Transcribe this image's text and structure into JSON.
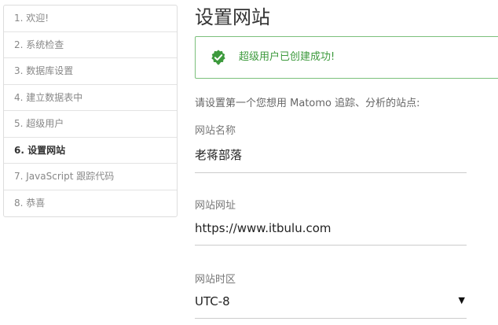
{
  "steps": [
    {
      "label": "1. 欢迎!"
    },
    {
      "label": "2. 系统检查"
    },
    {
      "label": "3. 数据库设置"
    },
    {
      "label": "4. 建立数据表中"
    },
    {
      "label": "5. 超级用户"
    },
    {
      "label": "6. 设置网站"
    },
    {
      "label": "7. JavaScript 跟踪代码"
    },
    {
      "label": "8. 恭喜"
    }
  ],
  "active_step_index": 5,
  "main": {
    "title": "设置网站",
    "alert": {
      "icon": "check-badge-icon",
      "message": "超级用户已创建成功!",
      "color": "#3d9a3d"
    },
    "intro": "请设置第一个您想用 Matomo 追踪、分析的站点:",
    "site_name": {
      "label": "网站名称",
      "value": "老蒋部落"
    },
    "site_url": {
      "label": "网站网址",
      "value": "https://www.itbulu.com"
    },
    "timezone": {
      "label": "网站时区",
      "value": "UTC-8",
      "icon": "caret-down-icon"
    }
  }
}
